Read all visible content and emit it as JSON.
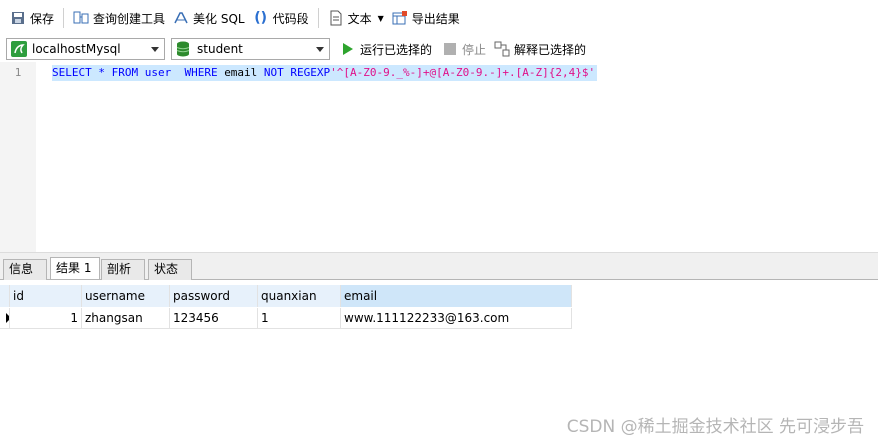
{
  "toolbar": {
    "save_label": "保存",
    "query_builder_label": "查询创建工具",
    "beautify_label": "美化 SQL",
    "snippet_label": "代码段",
    "text_label": "文本",
    "export_label": "导出结果"
  },
  "runbar": {
    "connection": "localhostMysql",
    "database": "student",
    "run_selected_label": "运行已选择的",
    "stop_label": "停止",
    "explain_label": "解释已选择的"
  },
  "editor": {
    "line_number": "1",
    "sql_parts": {
      "p1": "SELECT * FROM user  WHERE ",
      "p2": "email",
      "p3": " NOT REGEXP",
      "p4": "'^[A-Z0-9._%-]+@[A-Z0-9.-]+.[A-Z]{2,4}$'"
    }
  },
  "tabs": [
    "信息",
    "结果 1",
    "剖析",
    "状态"
  ],
  "result": {
    "columns": [
      "id",
      "username",
      "password",
      "quanxian",
      "email"
    ],
    "rows": [
      [
        "1",
        "zhangsan",
        "123456",
        "1",
        "www.111122233@163.com"
      ]
    ]
  },
  "watermark": "CSDN @稀土掘金技术社区 先可浸步吾",
  "colors": {
    "keyword": "#0000ff",
    "string": "#e0108a",
    "selection": "#cce8ff",
    "header": "#e7f1fb",
    "run_icon": "#2ea42e",
    "db_icon": "#2e8b2e"
  }
}
